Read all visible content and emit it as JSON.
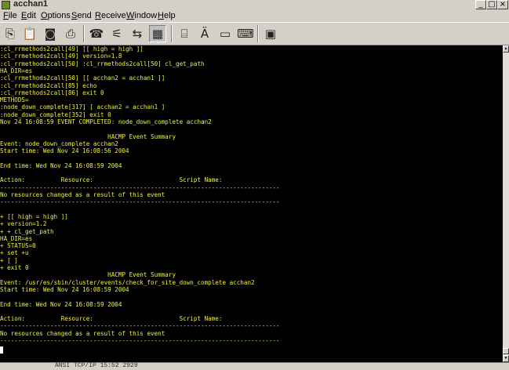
{
  "window": {
    "title": "acchan1"
  },
  "menu": [
    {
      "label": "File",
      "u": "F",
      "rest": "ile"
    },
    {
      "label": "Edit",
      "u": "E",
      "rest": "dit"
    },
    {
      "label": "Options",
      "u": "O",
      "rest": "ptions"
    },
    {
      "label": "Send",
      "u": "S",
      "rest": "end"
    },
    {
      "label": "Receive",
      "u": "R",
      "rest": "eceive"
    },
    {
      "label": "Window",
      "u": "W",
      "rest": "indow"
    },
    {
      "label": "Help",
      "u": "H",
      "rest": "elp"
    }
  ],
  "toolbar": {
    "icons": [
      "copy-icon",
      "paste-icon",
      "camera-icon",
      "print-icon",
      "phone-icon",
      "wand-icon",
      "transfer-icon",
      "grid-icon",
      "printer-setup-icon",
      "spellcheck-icon",
      "terminal-icon",
      "keyboard-icon",
      "macro-icon"
    ]
  },
  "terminal": {
    "lines": [
      ":cl_rrmethods2call[49] [[ high = high ]]",
      ":cl_rrmethods2call[49] version=1.8",
      ":cl_rrmethods2call[50] :cl_rrmethods2call[50] cl_get_path",
      "HA_DIR=es",
      ":cl_rrmethods2call[50] [[ acchan2 = acchan1 ]]",
      ":cl_rrmethods2call[85] echo",
      ":cl_rrmethods2call[86] exit 0",
      "METHODS=",
      ":node_down_complete[317] [ acchan2 = acchan1 ]",
      ":node_down_complete[352] exit 0",
      "Nov 24 16:08:59 EVENT COMPLETED: node_down_complete acchan2",
      "",
      "                              HACMP Event Summary",
      "Event: node_down_complete acchan2",
      "Start time: Wed Nov 24 16:08:56 2004",
      "",
      "End time: Wed Nov 24 16:08:59 2004",
      "",
      "Action:          Resource:                        Script Name:",
      "------------------------------------------------------------------------------",
      "No resources changed as a result of this event",
      "------------------------------------------------------------------------------",
      "",
      "+ [[ high = high ]]",
      "+ version=1.2",
      "+ + cl_get_path",
      "HA_DIR=es",
      "+ STATUS=0",
      "+ set +u",
      "+ [ ]",
      "+ exit 0",
      "                              HACMP Event Summary",
      "Event: /usr/es/sbin/cluster/events/check_for_site_down_complete acchan2",
      "Start time: Wed Nov 24 16:08:59 2004",
      "",
      "End time: Wed Nov 24 16:08:59 2004",
      "",
      "Action:          Resource:                        Script Name:",
      "------------------------------------------------------------------------------",
      "No resources changed as a result of this event",
      "------------------------------------------------------------------------------"
    ]
  },
  "status": {
    "text": "ANSI  TCP/IP  15:52  2929"
  },
  "colors": {
    "terminal_bg": "#000000",
    "terminal_fg": "#f0f040"
  }
}
